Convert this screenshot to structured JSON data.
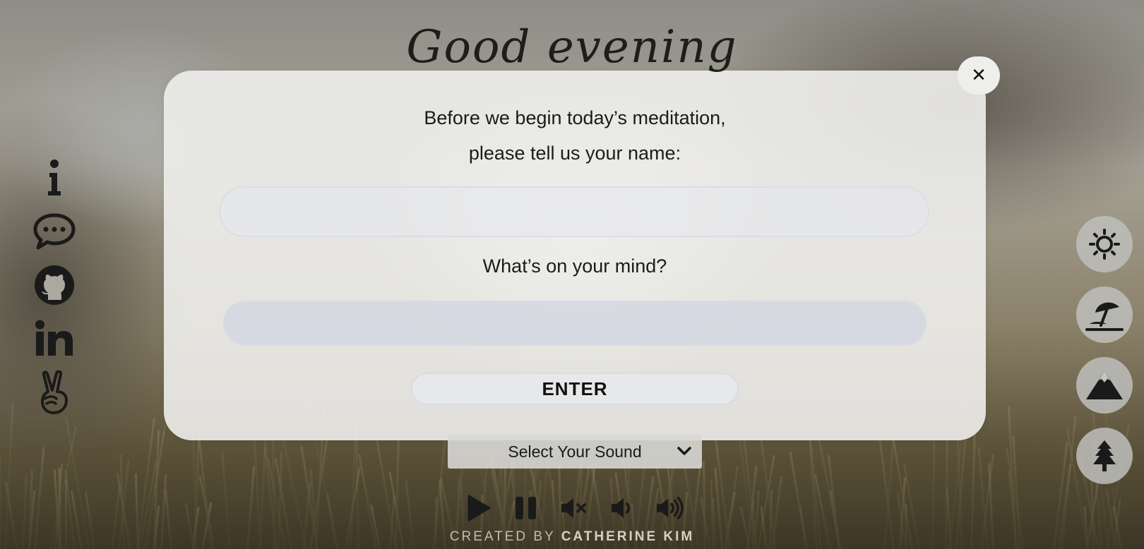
{
  "greeting": "Good evening",
  "modal": {
    "close_label": "✕",
    "prompt_line1": "Before we begin today’s meditation,",
    "prompt_line2": "please tell us your name:",
    "name_value": "",
    "mind_question": "What’s on your mind?",
    "mind_value": "",
    "enter_label": "ENTER"
  },
  "sound": {
    "selected": "Select Your Sound"
  },
  "player": {
    "controls": [
      "play-icon",
      "pause-icon",
      "mute-icon",
      "volume-low-icon",
      "volume-high-icon"
    ]
  },
  "credit": {
    "prefix": "CREATED BY",
    "author": "CATHERINE KIM"
  },
  "sidebar_left": {
    "icons": [
      "info-icon",
      "chat-icon",
      "github-icon",
      "linkedin-icon",
      "peace-hand-icon"
    ]
  },
  "theme_buttons": {
    "icons": [
      "sun-icon",
      "beach-umbrella-icon",
      "mountain-icon",
      "tree-icon"
    ]
  },
  "colors": {
    "icon": "#1a1a1a",
    "modal_bg": "#eeeeec",
    "input_border": "#d9dbe4"
  }
}
